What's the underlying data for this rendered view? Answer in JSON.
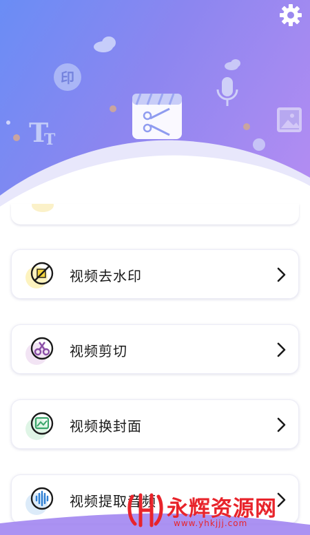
{
  "header": {
    "settings_icon": "gear-icon",
    "decorations": [
      "cloud-icon",
      "stamp-icon",
      "text-size-icon",
      "video-edit-icon",
      "microphone-icon",
      "image-icon"
    ],
    "stamp_glyph": "印",
    "text_glyph": "TT",
    "colors": {
      "gradient_start": "#6a8df5",
      "gradient_end": "#b58df2"
    }
  },
  "menu": {
    "items": [
      {
        "label": "视频去水印",
        "icon": "no-watermark-icon"
      },
      {
        "label": "视频剪切",
        "icon": "scissors-icon"
      },
      {
        "label": "视频换封面",
        "icon": "cover-image-icon"
      },
      {
        "label": "视频提取音频",
        "icon": "audio-wave-icon"
      }
    ]
  },
  "watermark": {
    "text": "永辉资源网",
    "url": "www.yhkjjj.com",
    "color": "#e8242b"
  }
}
